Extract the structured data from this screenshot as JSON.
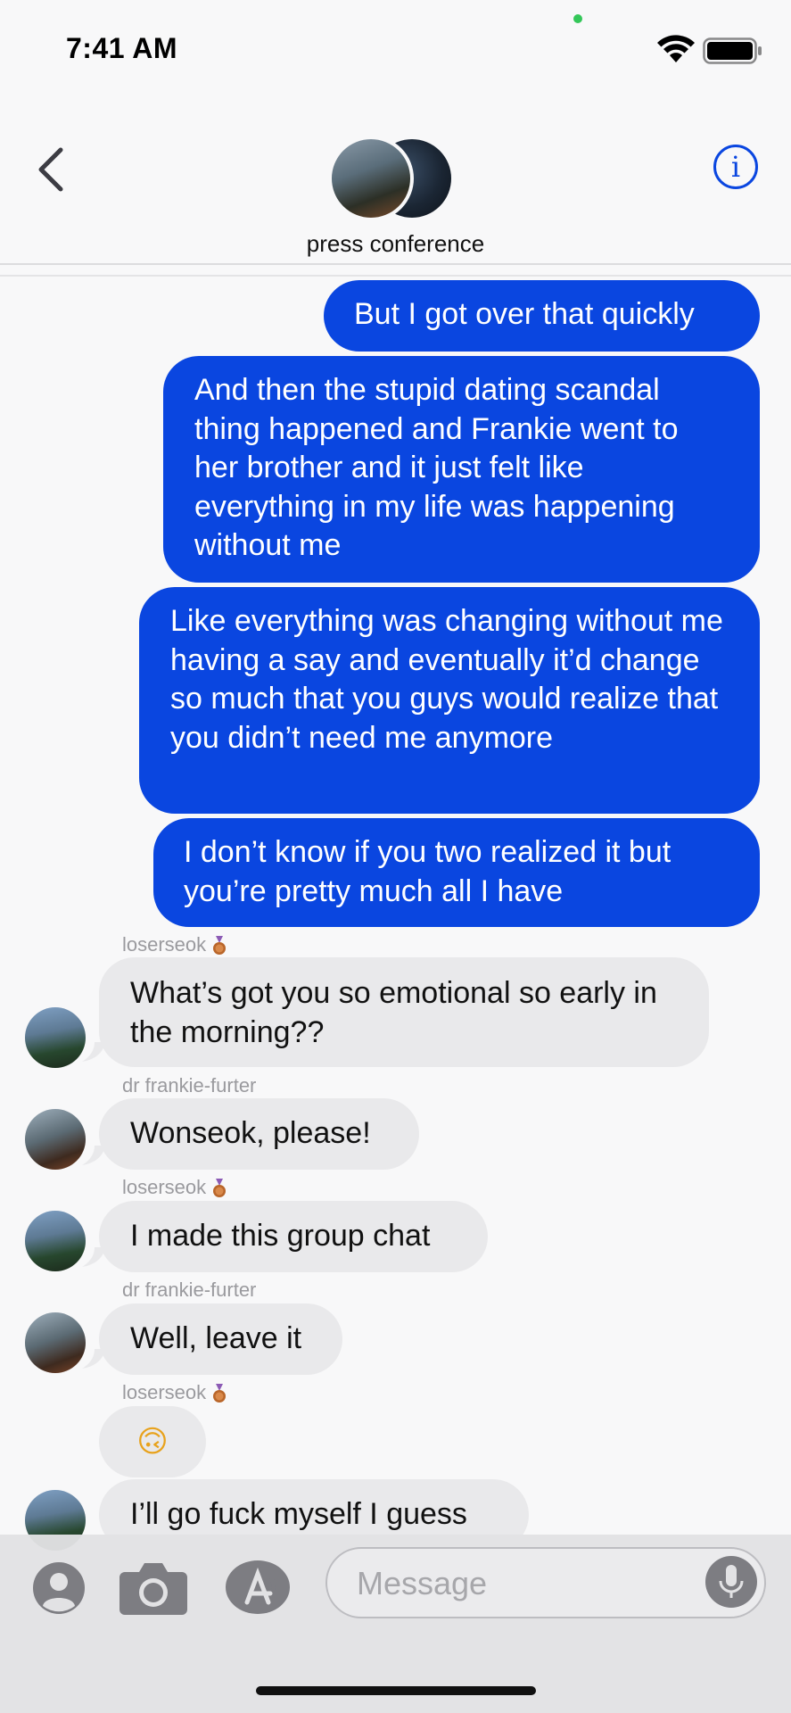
{
  "status_bar": {
    "time": "7:41 AM"
  },
  "header": {
    "group_name": "press conference",
    "info_label": "i"
  },
  "messages": [
    {
      "text": "But I got over that quickly"
    },
    {
      "text": "And then the stupid dating scandal thing happened and Frankie went to her brother and it just felt like everything in my life was happening without me"
    },
    {
      "text": "Like everything was changing without me having a say and eventually it’d change so much that you guys would realize that you didn’t need me anymore"
    },
    {
      "text": "I don’t know if you two realized it but you’re pretty much all I have"
    },
    {
      "sender": "loserseok",
      "text": "What’s got you so emotional so early in the morning??"
    },
    {
      "sender": "dr frankie-furter",
      "text": "Wonseok, please!"
    },
    {
      "sender": "loserseok",
      "text": "I made this group chat"
    },
    {
      "sender": "dr frankie-furter",
      "text": "Well, leave it"
    },
    {
      "sender": "loserseok",
      "text": "🙃"
    },
    {
      "text": "I’ll go fuck myself I guess"
    }
  ],
  "composer": {
    "placeholder": "Message"
  },
  "colors": {
    "accent": "#0a46e0",
    "incoming": "#e9e9eb",
    "background": "#f8f8f9"
  },
  "icons": [
    "back-chevron-icon",
    "info-icon",
    "contacts-icon",
    "camera-icon",
    "app-store-icon",
    "microphone-icon"
  ]
}
